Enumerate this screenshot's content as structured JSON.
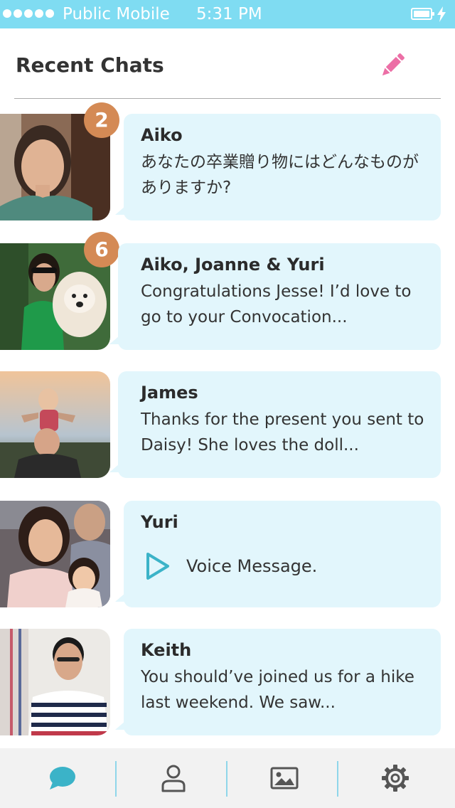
{
  "status_bar": {
    "carrier": "Public Mobile",
    "time": "5:31 PM",
    "signal_icon": "signal-dots-icon",
    "battery_icon": "battery-icon",
    "charging_icon": "bolt-icon"
  },
  "header": {
    "title": "Recent Chats",
    "compose_icon": "pencil-icon"
  },
  "chats": [
    {
      "name": "Aiko",
      "preview": "あなたの卒業贈り物にはどんなものがありますか?",
      "unread": "2"
    },
    {
      "name": "Aiko, Joanne & Yuri",
      "preview": "Congratulations Jesse! I’d love to go to your Convocation...",
      "unread": "6"
    },
    {
      "name": "James",
      "preview": "Thanks for the present you sent to Daisy! She loves the doll..."
    },
    {
      "name": "Yuri",
      "voice_label": "Voice Message.",
      "voice_icon": "play-icon"
    },
    {
      "name": "Keith",
      "preview": "You should’ve joined us for a hike last weekend. We saw..."
    }
  ],
  "tabs": [
    {
      "icon": "chat-bubble-icon",
      "active": true
    },
    {
      "icon": "person-icon",
      "active": false
    },
    {
      "icon": "image-icon",
      "active": false
    },
    {
      "icon": "gear-icon",
      "active": false
    }
  ],
  "colors": {
    "status_bar": "#7fdcf2",
    "bubble": "#e2f6fc",
    "badge": "#d48a55",
    "accent": "#3bb3c8",
    "compose": "#ec6fa6",
    "tab_bar": "#f2f2f2"
  }
}
